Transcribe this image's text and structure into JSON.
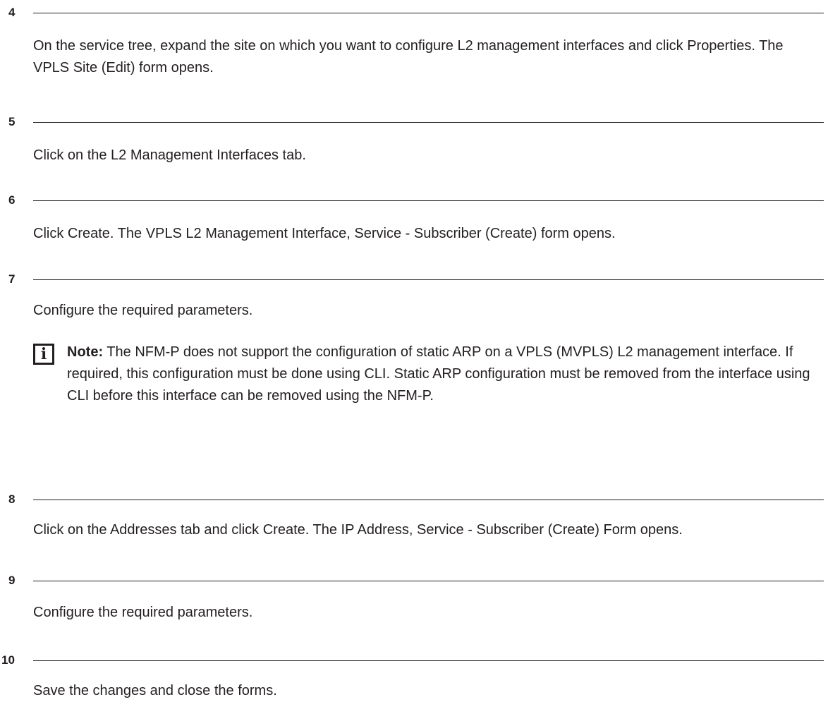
{
  "steps": [
    {
      "number": "4",
      "text": "On the service tree, expand the site on which you want to configure L2 management interfaces and click Properties. The VPLS Site (Edit) form opens."
    },
    {
      "number": "5",
      "text": "Click on the L2 Management Interfaces tab."
    },
    {
      "number": "6",
      "text": "Click Create. The VPLS L2 Management Interface, Service - Subscriber (Create) form opens."
    },
    {
      "number": "7",
      "text": "Configure the required parameters.",
      "note": {
        "icon": "info-icon",
        "icon_glyph": "i",
        "label": "Note:",
        "text": " The NFM-P does not support the configuration of static ARP on a VPLS (MVPLS) L2 management interface. If required, this configuration must be done using CLI. Static ARP configuration must be removed from the interface using CLI before this interface can be removed using the NFM-P."
      }
    },
    {
      "number": "8",
      "text": "Click on the Addresses tab and click Create. The IP Address, Service - Subscriber (Create) Form opens."
    },
    {
      "number": "9",
      "text": "Configure the required parameters."
    },
    {
      "number": "10",
      "text": "Save the changes and close the forms."
    }
  ]
}
